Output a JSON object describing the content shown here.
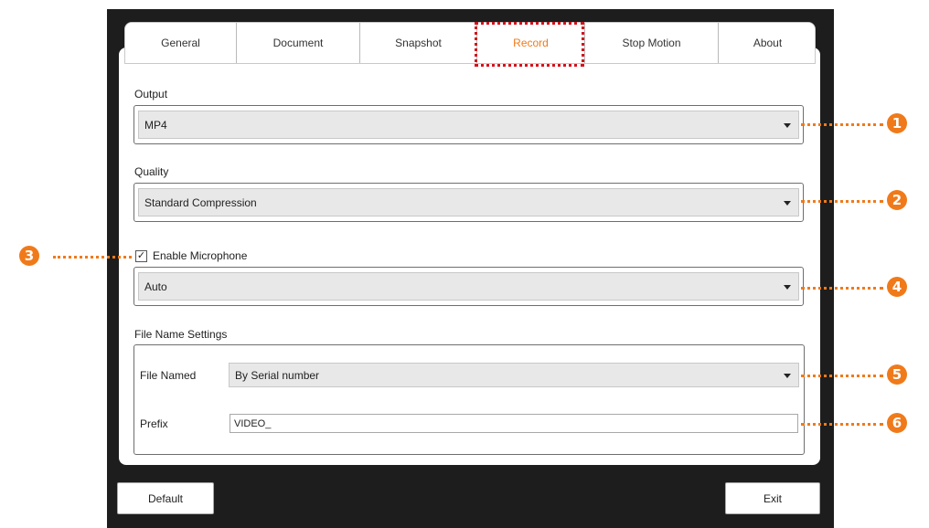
{
  "tabs": [
    {
      "label": "General"
    },
    {
      "label": "Document"
    },
    {
      "label": "Snapshot"
    },
    {
      "label": "Record",
      "active": true
    },
    {
      "label": "Stop Motion"
    },
    {
      "label": "About"
    }
  ],
  "output": {
    "label": "Output",
    "value": "MP4"
  },
  "quality": {
    "label": "Quality",
    "value": "Standard Compression"
  },
  "microphone": {
    "label": "Enable Microphone",
    "checked": true,
    "value": "Auto"
  },
  "file_name_settings": {
    "title": "File Name Settings",
    "file_named_label": "File Named",
    "file_named_value": "By Serial number",
    "prefix_label": "Prefix",
    "prefix_value": "VIDEO_"
  },
  "buttons": {
    "default": "Default",
    "exit": "Exit"
  },
  "callouts": [
    "1",
    "2",
    "3",
    "4",
    "5",
    "6"
  ],
  "colors": {
    "accent": "#f07a1a",
    "highlight": "#d4121a",
    "window_bg": "#1d1d1d"
  }
}
